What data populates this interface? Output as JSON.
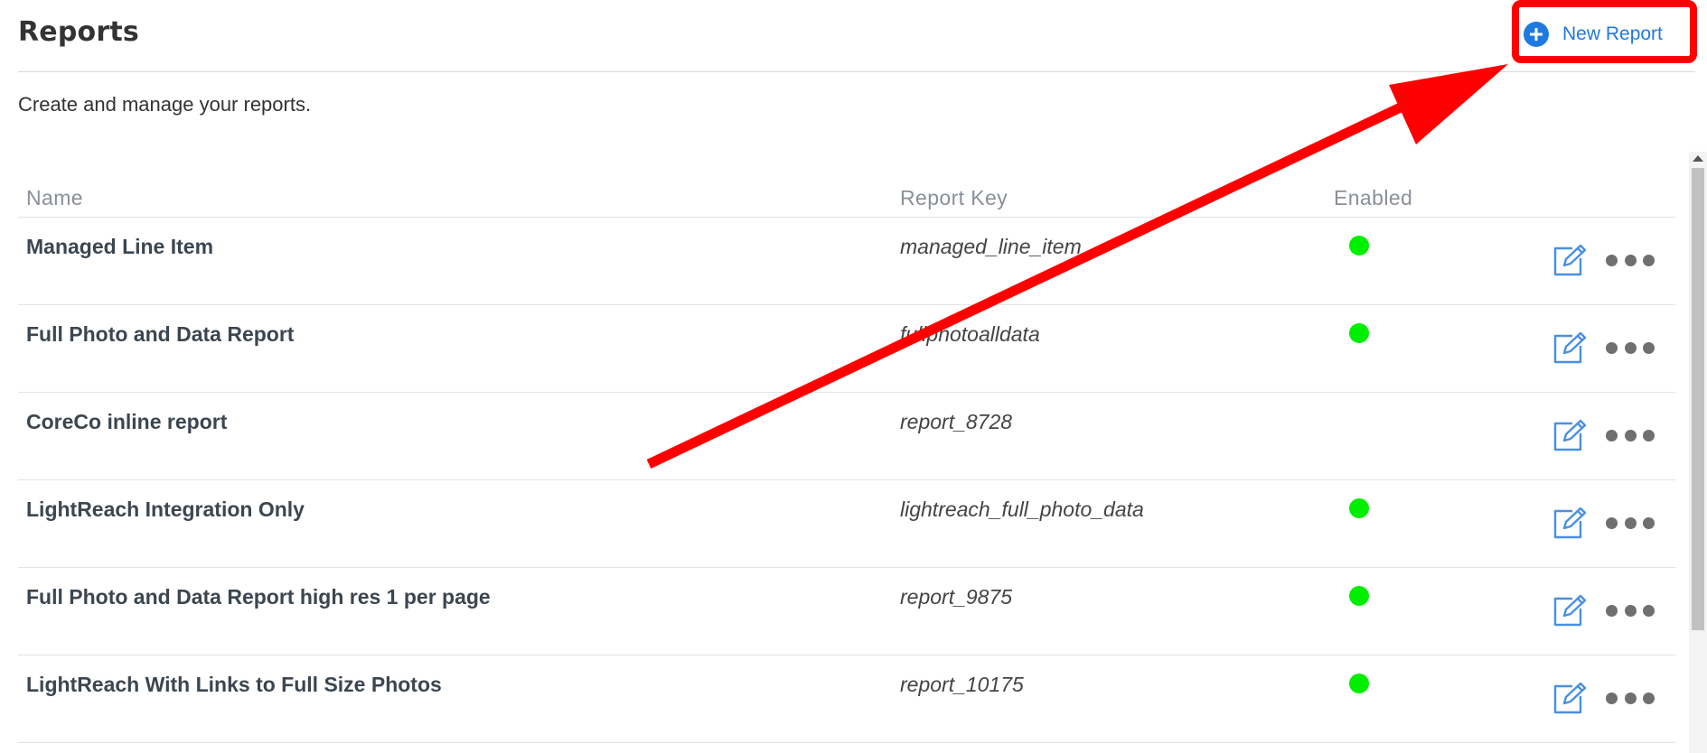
{
  "header": {
    "title": "Reports",
    "new_report_label": "New Report"
  },
  "subtitle": "Create and manage your reports.",
  "table": {
    "columns": [
      "Name",
      "Report Key",
      "Enabled"
    ],
    "rows": [
      {
        "name": "Managed Line Item",
        "key": "managed_line_item",
        "enabled": true
      },
      {
        "name": "Full Photo and Data Report",
        "key": "fullphotoalldata",
        "enabled": true
      },
      {
        "name": "CoreCo inline report",
        "key": "report_8728",
        "enabled": false
      },
      {
        "name": "LightReach Integration Only",
        "key": "lightreach_full_photo_data",
        "enabled": true
      },
      {
        "name": "Full Photo and Data Report high res 1 per page",
        "key": "report_9875",
        "enabled": true
      },
      {
        "name": "LightReach With Links to Full Size Photos",
        "key": "report_10175",
        "enabled": true
      }
    ]
  },
  "icons": {
    "add": "plus-circle-icon",
    "edit": "edit-icon",
    "more": "more-options-icon"
  },
  "colors": {
    "accent": "#1f7ae0",
    "enabled": "#00ee00",
    "annotation": "#ff0000"
  }
}
